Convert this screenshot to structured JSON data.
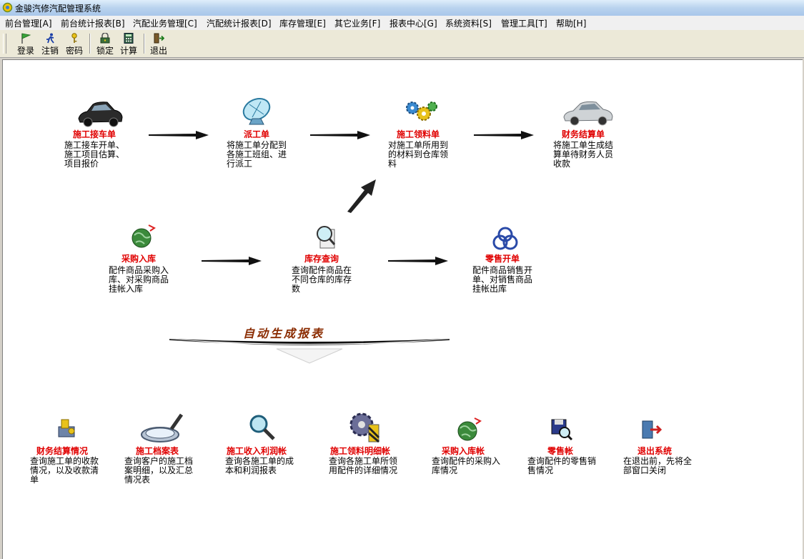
{
  "window": {
    "title": "金骏汽修汽配管理系统"
  },
  "menu": [
    {
      "label": "前台管理[A]"
    },
    {
      "label": "前台统计报表[B]"
    },
    {
      "label": "汽配业务管理[C]"
    },
    {
      "label": "汽配统计报表[D]"
    },
    {
      "label": "库存管理[E]"
    },
    {
      "label": "其它业务[F]"
    },
    {
      "label": "报表中心[G]"
    },
    {
      "label": "系统资料[S]"
    },
    {
      "label": "管理工具[T]"
    },
    {
      "label": "帮助[H]"
    }
  ],
  "toolbar": [
    {
      "label": "登录",
      "icon": "flag-icon"
    },
    {
      "label": "注销",
      "icon": "runner-icon"
    },
    {
      "label": "密码",
      "icon": "key-icon"
    },
    {
      "label": "锁定",
      "icon": "lock-icon"
    },
    {
      "label": "计算",
      "icon": "calculator-icon"
    },
    {
      "label": "退出",
      "icon": "exit-icon"
    }
  ],
  "flow": {
    "row1": [
      {
        "title": "施工接车单",
        "desc": "施工接车开单、施工项目估算、项目报价",
        "icon": "black-car-icon"
      },
      {
        "title": "派工单",
        "desc": "将施工单分配到各施工班组、进行派工",
        "icon": "satellite-dish-icon"
      },
      {
        "title": "施工领料单",
        "desc": "对施工单所用到的材料到仓库领料",
        "icon": "gears-icon"
      },
      {
        "title": "财务结算单",
        "desc": "将施工单生成结算单待财务人员收款",
        "icon": "silver-car-icon"
      }
    ],
    "row2": [
      {
        "title": "采购入库",
        "desc": "配件商品采购入库、对采购商品挂帐入库",
        "icon": "globe-icon"
      },
      {
        "title": "库存查询",
        "desc": "查询配件商品在不同仓库的库存数",
        "icon": "magnifier-doc-icon"
      },
      {
        "title": "零售开单",
        "desc": "配件商品销售开单、对销售商品挂帐出库",
        "icon": "knot-icon"
      }
    ],
    "banner": "自动生成报表"
  },
  "reports": [
    {
      "title": "财务结算情况",
      "desc": "查询施工单的收款情况，以及收款清单",
      "icon": "cash-icon"
    },
    {
      "title": "施工档案表",
      "desc": "查询客户的施工档案明细，以及汇总情况表",
      "icon": "magnifier-large-icon"
    },
    {
      "title": "施工收入利润帐",
      "desc": "查询各施工单的成本和利润报表",
      "icon": "magnifier-icon"
    },
    {
      "title": "施工领料明细帐",
      "desc": "查询各施工单所领用配件的详细情况",
      "icon": "gear-block-icon"
    },
    {
      "title": "采购入库帐",
      "desc": "查询配件的采购入库情况",
      "icon": "globe-icon"
    },
    {
      "title": "零售帐",
      "desc": "查询配件的零售销售情况",
      "icon": "disk-search-icon"
    },
    {
      "title": "退出系统",
      "desc": "在退出前，先将全部窗口关闭",
      "icon": "exit-door-icon"
    }
  ]
}
